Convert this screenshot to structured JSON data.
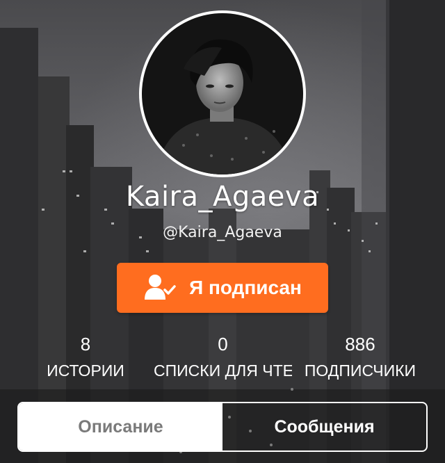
{
  "profile": {
    "username": "Kaira_Agaeva",
    "handle": "@Kaira_Agaeva",
    "avatar_icon": "profile-photo"
  },
  "follow_button": {
    "label": "Я подписан",
    "icon": "user-check-icon",
    "color": "#ff6d1f"
  },
  "stats": [
    {
      "value": "8",
      "label": "ИСТОРИИ"
    },
    {
      "value": "0",
      "label": "СПИСКИ ДЛЯ ЧТЕ"
    },
    {
      "value": "886",
      "label": "ПОДПИСЧИКИ"
    }
  ],
  "tabs": [
    {
      "label": "Описание",
      "active": true
    },
    {
      "label": "Сообщения",
      "active": false
    }
  ]
}
